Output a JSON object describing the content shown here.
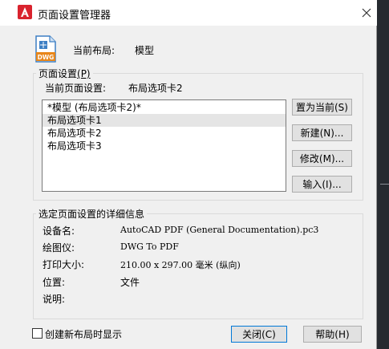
{
  "window": {
    "title": "页面设置管理器",
    "close_glyph": "✕"
  },
  "current_layout": {
    "label": "当前布局:",
    "value": "模型",
    "icon_text": "DWG"
  },
  "page_setups_group": {
    "title": "页面设置",
    "title_key": "(P)",
    "current_label": "当前页面设置:",
    "current_value": "布局选项卡2",
    "items": [
      "*模型 (布局选项卡2)*",
      "布局选项卡1",
      "布局选项卡2",
      "布局选项卡3"
    ],
    "selected_index": 1
  },
  "buttons": {
    "set_current": "置为当前(S)",
    "new": "新建(N)...",
    "modify": "修改(M)...",
    "import": "输入(I)...",
    "close": "关闭(C)",
    "help": "帮助(H)"
  },
  "details_group": {
    "title": "选定页面设置的详细信息",
    "rows": [
      {
        "label": "设备名:",
        "value": "AutoCAD PDF (General Documentation).pc3"
      },
      {
        "label": "绘图仪:",
        "value": "DWG To PDF"
      },
      {
        "label": "打印大小:",
        "value": "210.00 x 297.00 毫米 (纵向)"
      },
      {
        "label": "位置:",
        "value": "文件"
      },
      {
        "label": "说明:",
        "value": ""
      }
    ]
  },
  "checkbox": {
    "label": "创建新布局时显示",
    "checked": false
  },
  "colors": {
    "autocad_red": "#d9232e",
    "dwg_orange": "#e8861a",
    "doc_blue": "#3d7fc4",
    "focus_blue": "#0078d7"
  }
}
